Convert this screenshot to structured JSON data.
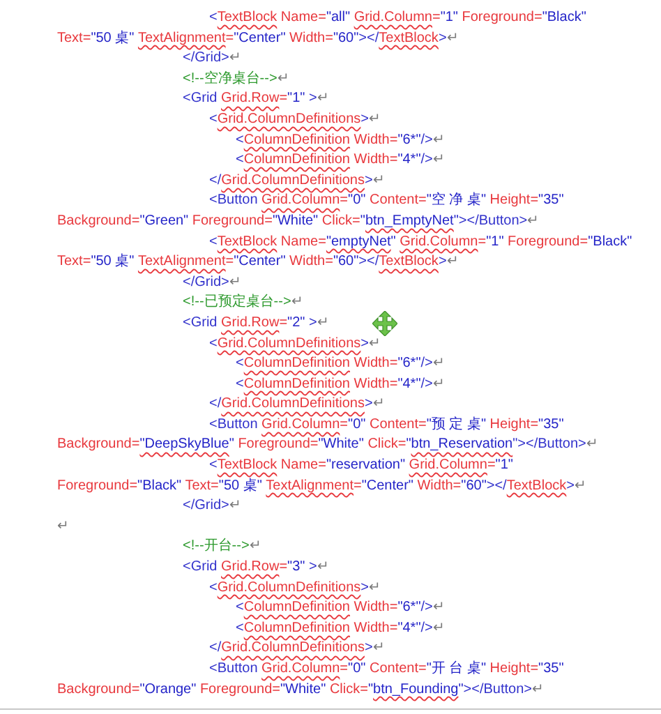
{
  "document": {
    "paragraphs": [
      {
        "kind": "code",
        "children": [
          {
            "kind": "code",
            "mark": "↵",
            "lines": [
              [
                {
                  "kind": "bracket",
                  "text": "<",
                  "flagged": false
                },
                {
                  "kind": "attribute",
                  "text": "TextBlock",
                  "flagged": true
                },
                {
                  "kind": "attribute",
                  "text": " Name=",
                  "flagged": false
                },
                {
                  "kind": "value",
                  "text": "\"all\" ",
                  "flagged": false
                },
                {
                  "kind": "attribute",
                  "text": "Grid.Column",
                  "flagged": true
                },
                {
                  "kind": "attribute",
                  "text": "=",
                  "flagged": false
                },
                {
                  "kind": "value",
                  "text": "\"1\" ",
                  "flagged": false
                },
                {
                  "kind": "attribute",
                  "text": "Foreground=",
                  "flagged": false
                },
                {
                  "kind": "value",
                  "text": "\"Black\"",
                  "flagged": false
                }
              ],
              [
                {
                  "kind": "attribute",
                  "text": "Text=",
                  "flagged": false
                },
                {
                  "kind": "value",
                  "text": "\"50 桌\" ",
                  "flagged": false
                },
                {
                  "kind": "attribute",
                  "text": "TextAlignment",
                  "flagged": true
                },
                {
                  "kind": "attribute",
                  "text": "=",
                  "flagged": false
                },
                {
                  "kind": "value",
                  "text": "\"Center\" ",
                  "flagged": false
                },
                {
                  "kind": "attribute",
                  "text": "Width=",
                  "flagged": false
                },
                {
                  "kind": "value",
                  "text": "\"60\"",
                  "flagged": false
                },
                {
                  "kind": "bracket",
                  "text": "></",
                  "flagged": false
                },
                {
                  "kind": "attribute",
                  "text": "TextBlock",
                  "flagged": true
                },
                {
                  "kind": "bracket",
                  "text": ">",
                  "flagged": false
                }
              ]
            ]
          }
        ]
      },
      {
        "kind": "code",
        "mark": "↵",
        "lines": [
          [
            {
              "kind": "bracket",
              "text": "</Grid>",
              "flagged": false
            }
          ]
        ]
      },
      {
        "kind": "code",
        "mark": "↵",
        "lines": [
          [
            {
              "kind": "comment",
              "text": "<!--空净桌台-->",
              "flagged": false
            }
          ]
        ]
      },
      {
        "kind": "code",
        "mark": "↵",
        "lines": [
          [
            {
              "kind": "bracket",
              "text": "<Grid ",
              "flagged": false
            },
            {
              "kind": "attribute",
              "text": "Grid.Row",
              "flagged": true
            },
            {
              "kind": "attribute",
              "text": "=",
              "flagged": false
            },
            {
              "kind": "value",
              "text": "\"1\" ",
              "flagged": false
            },
            {
              "kind": "bracket",
              "text": ">",
              "flagged": false
            }
          ]
        ],
        "children": [
          {
            "kind": "code",
            "mark": "↵",
            "lines": [
              [
                {
                  "kind": "bracket",
                  "text": "<",
                  "flagged": false
                },
                {
                  "kind": "attribute",
                  "text": "Grid.ColumnDefinitions",
                  "flagged": true
                },
                {
                  "kind": "bracket",
                  "text": ">",
                  "flagged": false
                }
              ]
            ],
            "children": [
              {
                "kind": "code",
                "mark": "↵",
                "lines": [
                  [
                    {
                      "kind": "bracket",
                      "text": "<",
                      "flagged": false
                    },
                    {
                      "kind": "attribute",
                      "text": "ColumnDefinition",
                      "flagged": true
                    },
                    {
                      "kind": "attribute",
                      "text": " Width=",
                      "flagged": false
                    },
                    {
                      "kind": "value",
                      "text": "\"6*\"",
                      "flagged": false
                    },
                    {
                      "kind": "bracket",
                      "text": "/>",
                      "flagged": false
                    }
                  ]
                ]
              },
              {
                "kind": "code",
                "mark": "↵",
                "lines": [
                  [
                    {
                      "kind": "bracket",
                      "text": "<",
                      "flagged": false
                    },
                    {
                      "kind": "attribute",
                      "text": "ColumnDefinition",
                      "flagged": true
                    },
                    {
                      "kind": "attribute",
                      "text": " Width=",
                      "flagged": false
                    },
                    {
                      "kind": "value",
                      "text": "\"4*\"",
                      "flagged": false
                    },
                    {
                      "kind": "bracket",
                      "text": "/>",
                      "flagged": false
                    }
                  ]
                ]
              }
            ]
          },
          {
            "kind": "code",
            "mark": "↵",
            "lines": [
              [
                {
                  "kind": "bracket",
                  "text": "</",
                  "flagged": false
                },
                {
                  "kind": "attribute",
                  "text": "Grid.ColumnDefinitions",
                  "flagged": true
                },
                {
                  "kind": "bracket",
                  "text": ">",
                  "flagged": false
                }
              ]
            ]
          },
          {
            "kind": "code",
            "mark": "↵",
            "lines": [
              [
                {
                  "kind": "bracket",
                  "text": "<Button ",
                  "flagged": false
                },
                {
                  "kind": "attribute",
                  "text": "Grid.Column",
                  "flagged": true
                },
                {
                  "kind": "attribute",
                  "text": "=",
                  "flagged": false
                },
                {
                  "kind": "value",
                  "text": "\"0\" ",
                  "flagged": false
                },
                {
                  "kind": "attribute",
                  "text": "Content=",
                  "flagged": false
                },
                {
                  "kind": "value",
                  "text": "\"空 净 桌\" ",
                  "flagged": false
                },
                {
                  "kind": "attribute",
                  "text": "Height=",
                  "flagged": false
                },
                {
                  "kind": "value",
                  "text": "\"35\"",
                  "flagged": false
                }
              ],
              [
                {
                  "kind": "attribute",
                  "text": "Background=",
                  "flagged": false
                },
                {
                  "kind": "value",
                  "text": "\"Green\" ",
                  "flagged": false
                },
                {
                  "kind": "attribute",
                  "text": "Foreground=",
                  "flagged": false
                },
                {
                  "kind": "value",
                  "text": "\"White\" ",
                  "flagged": false
                },
                {
                  "kind": "attribute",
                  "text": "Click=",
                  "flagged": false
                },
                {
                  "kind": "value",
                  "text": "\"",
                  "flagged": false
                },
                {
                  "kind": "value",
                  "text": "btn_EmptyNet",
                  "flagged": true
                },
                {
                  "kind": "value",
                  "text": "\"",
                  "flagged": false
                },
                {
                  "kind": "bracket",
                  "text": "></Button>",
                  "flagged": false
                }
              ]
            ]
          },
          {
            "kind": "code",
            "mark": "↵",
            "lines": [
              [
                {
                  "kind": "bracket",
                  "text": "<",
                  "flagged": false
                },
                {
                  "kind": "attribute",
                  "text": "TextBlock",
                  "flagged": true
                },
                {
                  "kind": "attribute",
                  "text": " Name=",
                  "flagged": false
                },
                {
                  "kind": "value",
                  "text": "\"emptyNet",
                  "flagged": true
                },
                {
                  "kind": "value",
                  "text": "\" ",
                  "flagged": false
                },
                {
                  "kind": "attribute",
                  "text": "Grid.Column",
                  "flagged": true
                },
                {
                  "kind": "attribute",
                  "text": "=",
                  "flagged": false
                },
                {
                  "kind": "value",
                  "text": "\"1\" ",
                  "flagged": false
                },
                {
                  "kind": "attribute",
                  "text": "Foreground=",
                  "flagged": false
                },
                {
                  "kind": "value",
                  "text": "\"Black\"",
                  "flagged": false
                }
              ],
              [
                {
                  "kind": "attribute",
                  "text": "Text=",
                  "flagged": false
                },
                {
                  "kind": "value",
                  "text": "\"50 桌\" ",
                  "flagged": false
                },
                {
                  "kind": "attribute",
                  "text": "TextAlignment",
                  "flagged": true
                },
                {
                  "kind": "attribute",
                  "text": "=",
                  "flagged": false
                },
                {
                  "kind": "value",
                  "text": "\"Center\" ",
                  "flagged": false
                },
                {
                  "kind": "attribute",
                  "text": "Width=",
                  "flagged": false
                },
                {
                  "kind": "value",
                  "text": "\"60\"",
                  "flagged": false
                },
                {
                  "kind": "bracket",
                  "text": "></",
                  "flagged": false
                },
                {
                  "kind": "attribute",
                  "text": "TextBlock",
                  "flagged": true
                },
                {
                  "kind": "bracket",
                  "text": ">",
                  "flagged": false
                }
              ]
            ]
          }
        ]
      },
      {
        "kind": "code",
        "mark": "↵",
        "lines": [
          [
            {
              "kind": "bracket",
              "text": "</Grid>",
              "flagged": false
            }
          ]
        ]
      },
      {
        "kind": "code",
        "mark": "↵",
        "lines": [
          [
            {
              "kind": "comment",
              "text": "<!--已预定桌台-->",
              "flagged": false
            }
          ]
        ]
      },
      {
        "kind": "code",
        "mark": "↵",
        "move_handle": true,
        "lines": [
          [
            {
              "kind": "bracket",
              "text": "<Grid ",
              "flagged": false
            },
            {
              "kind": "attribute",
              "text": "Grid.Row",
              "flagged": true
            },
            {
              "kind": "attribute",
              "text": "=",
              "flagged": false
            },
            {
              "kind": "value",
              "text": "\"2\" ",
              "flagged": false
            },
            {
              "kind": "bracket",
              "text": ">",
              "flagged": false
            }
          ]
        ],
        "children": [
          {
            "kind": "code",
            "mark": "↵",
            "lines": [
              [
                {
                  "kind": "bracket",
                  "text": "<",
                  "flagged": false
                },
                {
                  "kind": "attribute",
                  "text": "Grid.ColumnDefinitions",
                  "flagged": true
                },
                {
                  "kind": "bracket",
                  "text": ">",
                  "flagged": false
                }
              ]
            ],
            "children": [
              {
                "kind": "code",
                "mark": "↵",
                "lines": [
                  [
                    {
                      "kind": "bracket",
                      "text": "<",
                      "flagged": false
                    },
                    {
                      "kind": "attribute",
                      "text": "ColumnDefinition",
                      "flagged": true
                    },
                    {
                      "kind": "attribute",
                      "text": " Width=",
                      "flagged": false
                    },
                    {
                      "kind": "value",
                      "text": "\"6*\"",
                      "flagged": false
                    },
                    {
                      "kind": "bracket",
                      "text": "/>",
                      "flagged": false
                    }
                  ]
                ]
              },
              {
                "kind": "code",
                "mark": "↵",
                "lines": [
                  [
                    {
                      "kind": "bracket",
                      "text": "<",
                      "flagged": false
                    },
                    {
                      "kind": "attribute",
                      "text": "ColumnDefinition",
                      "flagged": true
                    },
                    {
                      "kind": "attribute",
                      "text": " Width=",
                      "flagged": false
                    },
                    {
                      "kind": "value",
                      "text": "\"4*\"",
                      "flagged": false
                    },
                    {
                      "kind": "bracket",
                      "text": "/>",
                      "flagged": false
                    }
                  ]
                ]
              }
            ]
          },
          {
            "kind": "code",
            "mark": "↵",
            "lines": [
              [
                {
                  "kind": "bracket",
                  "text": "</",
                  "flagged": false
                },
                {
                  "kind": "attribute",
                  "text": "Grid.ColumnDefinitions",
                  "flagged": true
                },
                {
                  "kind": "bracket",
                  "text": ">",
                  "flagged": false
                }
              ]
            ]
          },
          {
            "kind": "code",
            "mark": "↵",
            "lines": [
              [
                {
                  "kind": "bracket",
                  "text": "<Button ",
                  "flagged": false
                },
                {
                  "kind": "attribute",
                  "text": "Grid.Column",
                  "flagged": true
                },
                {
                  "kind": "attribute",
                  "text": "=",
                  "flagged": false
                },
                {
                  "kind": "value",
                  "text": "\"0\" ",
                  "flagged": false
                },
                {
                  "kind": "attribute",
                  "text": "Content=",
                  "flagged": false
                },
                {
                  "kind": "value",
                  "text": "\"预 定 桌\" ",
                  "flagged": false
                },
                {
                  "kind": "attribute",
                  "text": "Height=",
                  "flagged": false
                },
                {
                  "kind": "value",
                  "text": "\"35\"",
                  "flagged": false
                }
              ],
              [
                {
                  "kind": "attribute",
                  "text": "Background=",
                  "flagged": false
                },
                {
                  "kind": "value",
                  "text": "\"DeepSkyBlue",
                  "flagged": true
                },
                {
                  "kind": "value",
                  "text": "\" ",
                  "flagged": false
                },
                {
                  "kind": "attribute",
                  "text": "Foreground=",
                  "flagged": false
                },
                {
                  "kind": "value",
                  "text": "\"White\" ",
                  "flagged": false
                },
                {
                  "kind": "attribute",
                  "text": "Click=",
                  "flagged": false
                },
                {
                  "kind": "value",
                  "text": "\"",
                  "flagged": false
                },
                {
                  "kind": "value",
                  "text": "btn_Reservation",
                  "flagged": true
                },
                {
                  "kind": "bracket",
                  "text": "\"></Button>",
                  "flagged": false
                }
              ]
            ]
          },
          {
            "kind": "code",
            "mark": "↵",
            "lines": [
              [
                {
                  "kind": "bracket",
                  "text": "<",
                  "flagged": false
                },
                {
                  "kind": "attribute",
                  "text": "TextBlock",
                  "flagged": true
                },
                {
                  "kind": "attribute",
                  "text": " Name=",
                  "flagged": false
                },
                {
                  "kind": "value",
                  "text": "\"reservation\" ",
                  "flagged": false
                },
                {
                  "kind": "attribute",
                  "text": "Grid.Column",
                  "flagged": true
                },
                {
                  "kind": "attribute",
                  "text": "=",
                  "flagged": false
                },
                {
                  "kind": "value",
                  "text": "\"1\"",
                  "flagged": false
                }
              ],
              [
                {
                  "kind": "attribute",
                  "text": "Foreground=",
                  "flagged": false
                },
                {
                  "kind": "value",
                  "text": "\"Black\" ",
                  "flagged": false
                },
                {
                  "kind": "attribute",
                  "text": "Text=",
                  "flagged": false
                },
                {
                  "kind": "value",
                  "text": "\"50 桌\" ",
                  "flagged": false
                },
                {
                  "kind": "attribute",
                  "text": "TextAlignment",
                  "flagged": true
                },
                {
                  "kind": "attribute",
                  "text": "=",
                  "flagged": false
                },
                {
                  "kind": "value",
                  "text": "\"Center\" ",
                  "flagged": false
                },
                {
                  "kind": "attribute",
                  "text": "Width=",
                  "flagged": false
                },
                {
                  "kind": "value",
                  "text": "\"60\"",
                  "flagged": false
                },
                {
                  "kind": "bracket",
                  "text": "></",
                  "flagged": false
                },
                {
                  "kind": "attribute",
                  "text": "TextBlock",
                  "flagged": true
                },
                {
                  "kind": "bracket",
                  "text": ">",
                  "flagged": false
                }
              ]
            ]
          }
        ]
      },
      {
        "kind": "code",
        "mark": "↵",
        "lines": [
          [
            {
              "kind": "bracket",
              "text": "</Grid>",
              "flagged": false
            }
          ]
        ]
      },
      {
        "kind": "empty",
        "mark": "↵"
      },
      {
        "kind": "code",
        "mark": "↵",
        "lines": [
          [
            {
              "kind": "comment",
              "text": "<!--开台-->",
              "flagged": false
            }
          ]
        ]
      },
      {
        "kind": "code",
        "mark": "↵",
        "lines": [
          [
            {
              "kind": "bracket",
              "text": "<Grid ",
              "flagged": false
            },
            {
              "kind": "attribute",
              "text": "Grid.Row",
              "flagged": true
            },
            {
              "kind": "attribute",
              "text": "=",
              "flagged": false
            },
            {
              "kind": "value",
              "text": "\"3\" ",
              "flagged": false
            },
            {
              "kind": "bracket",
              "text": ">",
              "flagged": false
            }
          ]
        ],
        "children": [
          {
            "kind": "code",
            "mark": "↵",
            "lines": [
              [
                {
                  "kind": "bracket",
                  "text": "<",
                  "flagged": false
                },
                {
                  "kind": "attribute",
                  "text": "Grid.ColumnDefinitions",
                  "flagged": true
                },
                {
                  "kind": "bracket",
                  "text": ">",
                  "flagged": false
                }
              ]
            ],
            "children": [
              {
                "kind": "code",
                "mark": "↵",
                "lines": [
                  [
                    {
                      "kind": "bracket",
                      "text": "<",
                      "flagged": false
                    },
                    {
                      "kind": "attribute",
                      "text": "ColumnDefinition",
                      "flagged": true
                    },
                    {
                      "kind": "attribute",
                      "text": " Width=",
                      "flagged": false
                    },
                    {
                      "kind": "value",
                      "text": "\"6*\"",
                      "flagged": false
                    },
                    {
                      "kind": "bracket",
                      "text": "/>",
                      "flagged": false
                    }
                  ]
                ]
              },
              {
                "kind": "code",
                "mark": "↵",
                "lines": [
                  [
                    {
                      "kind": "bracket",
                      "text": "<",
                      "flagged": false
                    },
                    {
                      "kind": "attribute",
                      "text": "ColumnDefinition",
                      "flagged": true
                    },
                    {
                      "kind": "attribute",
                      "text": " Width=",
                      "flagged": false
                    },
                    {
                      "kind": "value",
                      "text": "\"4*\"",
                      "flagged": false
                    },
                    {
                      "kind": "bracket",
                      "text": "/>",
                      "flagged": false
                    }
                  ]
                ]
              }
            ]
          },
          {
            "kind": "code",
            "mark": "↵",
            "lines": [
              [
                {
                  "kind": "bracket",
                  "text": "</",
                  "flagged": false
                },
                {
                  "kind": "attribute",
                  "text": "Grid.ColumnDefinitions",
                  "flagged": true
                },
                {
                  "kind": "bracket",
                  "text": ">",
                  "flagged": false
                }
              ]
            ]
          },
          {
            "kind": "code",
            "mark": "↵",
            "lines": [
              [
                {
                  "kind": "bracket",
                  "text": "<Button ",
                  "flagged": false
                },
                {
                  "kind": "attribute",
                  "text": "Grid.Column",
                  "flagged": true
                },
                {
                  "kind": "attribute",
                  "text": "=",
                  "flagged": false
                },
                {
                  "kind": "value",
                  "text": "\"0\" ",
                  "flagged": false
                },
                {
                  "kind": "attribute",
                  "text": "Content=",
                  "flagged": false
                },
                {
                  "kind": "value",
                  "text": "\"开 台 桌\" ",
                  "flagged": false
                },
                {
                  "kind": "attribute",
                  "text": "Height=",
                  "flagged": false
                },
                {
                  "kind": "value",
                  "text": "\"35\"",
                  "flagged": false
                }
              ],
              [
                {
                  "kind": "attribute",
                  "text": "Background=",
                  "flagged": false
                },
                {
                  "kind": "value",
                  "text": "\"Orange\" ",
                  "flagged": false
                },
                {
                  "kind": "attribute",
                  "text": "Foreground=",
                  "flagged": false
                },
                {
                  "kind": "value",
                  "text": "\"White\" ",
                  "flagged": false
                },
                {
                  "kind": "attribute",
                  "text": "Click=",
                  "flagged": false
                },
                {
                  "kind": "value",
                  "text": "\"",
                  "flagged": false
                },
                {
                  "kind": "value",
                  "text": "btn_Founding",
                  "flagged": true
                },
                {
                  "kind": "value",
                  "text": "\"",
                  "flagged": false
                },
                {
                  "kind": "bracket",
                  "text": "></Button>",
                  "flagged": false
                }
              ]
            ]
          }
        ]
      }
    ]
  }
}
